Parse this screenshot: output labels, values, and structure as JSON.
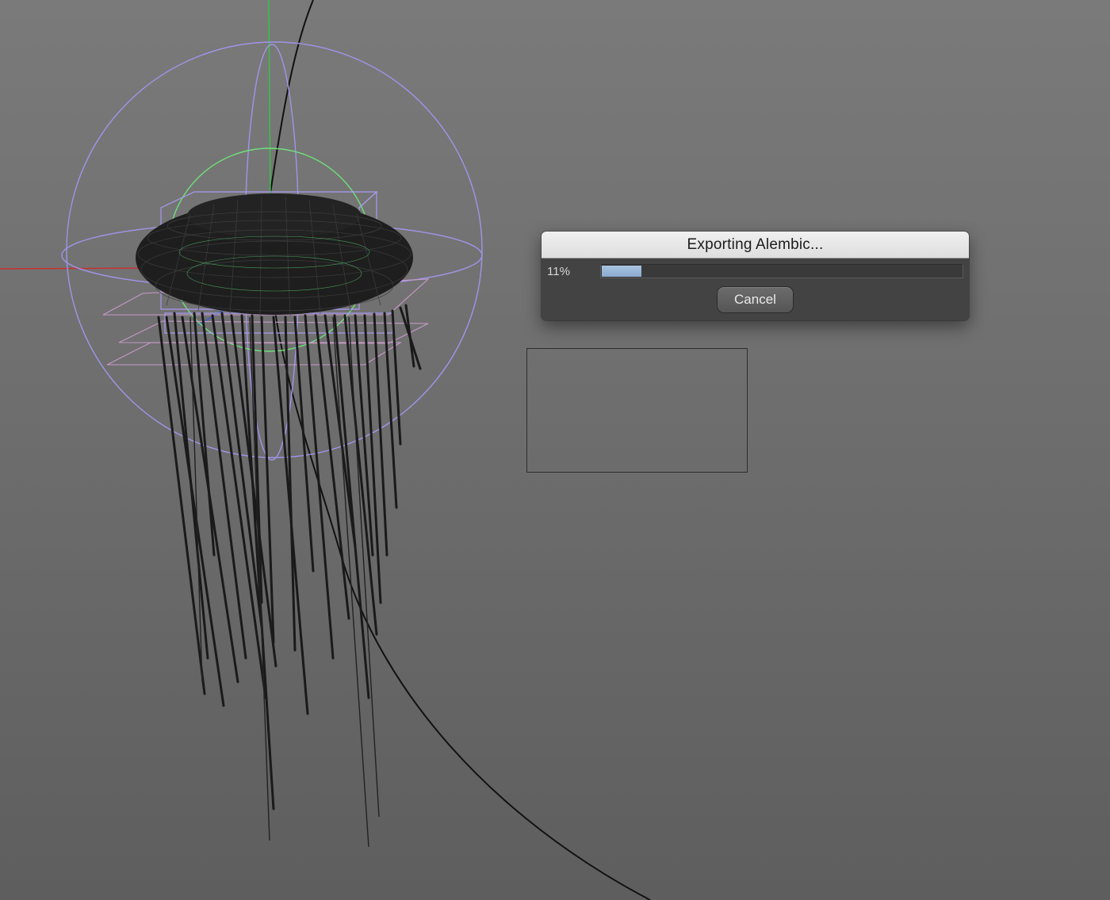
{
  "dialog": {
    "title": "Exporting Alembic...",
    "progress_label": "11%",
    "progress_fraction": 0.11,
    "cancel_label": "Cancel"
  },
  "scene": {
    "object": "jellyfish wireframe mesh",
    "colors": {
      "background_top": "#7a7a7a",
      "background_bottom": "#5e5e5e",
      "wireframe": "#1a1a1a",
      "manipulator": "#9f95e8",
      "manipulator_green": "#6fe07a",
      "axis_x": "#c83232",
      "axis_y": "#39c24a",
      "helper_planes": "#c79ac8",
      "progress_fill": "#94b2d8"
    }
  }
}
